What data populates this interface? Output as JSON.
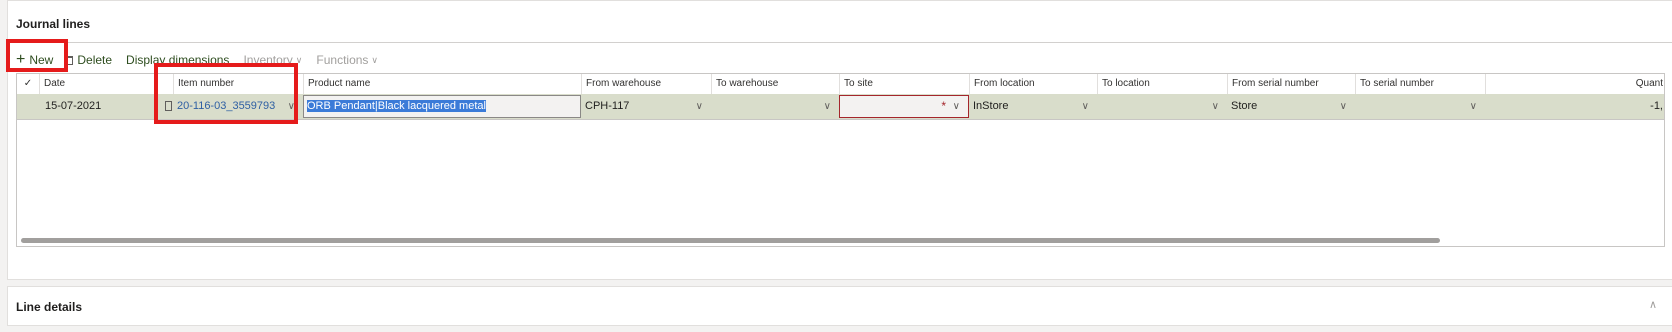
{
  "journal": {
    "title": "Journal lines",
    "toolbar": {
      "new": "New",
      "delete": "Delete",
      "display_dimensions": "Display dimensions",
      "inventory": "Inventory",
      "functions": "Functions"
    },
    "columns": [
      "Date",
      "Item number",
      "Product name",
      "From warehouse",
      "To warehouse",
      "To site",
      "From location",
      "To location",
      "From serial number",
      "To serial number",
      "Quant"
    ],
    "row": {
      "date": "15-07-2021",
      "item_number": "20-116-03_3559793",
      "product_name": "ORB Pendant|Black lacquered metal",
      "from_warehouse": "CPH-117",
      "to_warehouse": "",
      "to_site": "",
      "to_site_required": "*",
      "from_location": "InStore",
      "to_location": "",
      "from_serial": "Store",
      "to_serial": "",
      "quantity": "-1,"
    }
  },
  "details": {
    "title": "Line details"
  },
  "icons": {
    "new": "plus-icon",
    "delete": "trash-icon",
    "dropdown": "chevron-down-icon",
    "collapse": "chevron-up-icon",
    "check": "check-icon"
  },
  "colors": {
    "accent_green": "#2e4d1f",
    "row_selected": "#d9ddcb",
    "selection": "#3b7bd8",
    "required_border": "#a4262c",
    "highlight_box": "#e51b1b"
  }
}
